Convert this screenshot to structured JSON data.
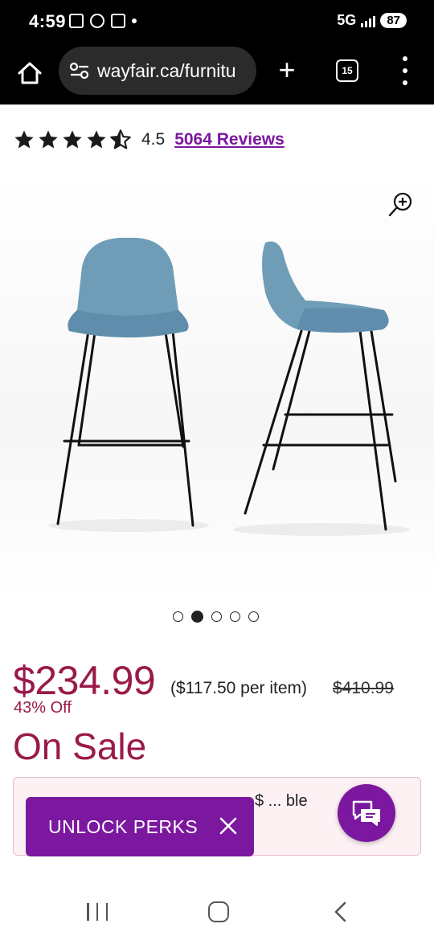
{
  "status_bar": {
    "time": "4:59",
    "network": "5G",
    "battery": "87"
  },
  "browser": {
    "url": "wayfair.ca/furnitu",
    "tab_count": "15"
  },
  "rating": {
    "value": "4.5",
    "stars": 4.5,
    "reviews_label": "5064 Reviews"
  },
  "gallery": {
    "total_images": 5,
    "active_index": 1
  },
  "pricing": {
    "price": "$234.99",
    "per_item": "($117.50 per item)",
    "was_price": "$410.99",
    "discount": "43% Off",
    "sale_label": "On Sale"
  },
  "promo": {
    "text": "$ ... ble"
  },
  "unlock": {
    "label": "UNLOCK PERKS"
  },
  "colors": {
    "brand_purple": "#7b189f",
    "sale_red": "#9a1a4a",
    "promo_bg": "#fdf1f4",
    "chair_blue": "#6f9db8"
  },
  "icons": {
    "home": "home-icon",
    "site_settings": "tune-icon",
    "new_tab": "plus-icon",
    "tabs": "tabs-icon",
    "menu": "more-vert-icon",
    "zoom": "zoom-in-icon",
    "close": "close-icon",
    "chat": "chat-icon"
  }
}
